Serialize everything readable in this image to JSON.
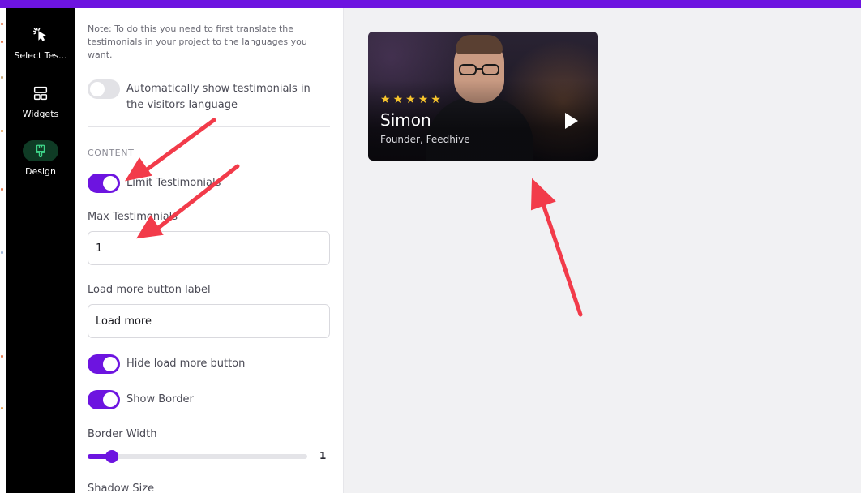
{
  "rail": {
    "items": [
      {
        "label": "Select Tes...",
        "icon": "cursor-click-icon"
      },
      {
        "label": "Widgets",
        "icon": "layout-icon"
      },
      {
        "label": "Design",
        "icon": "paintbrush-icon"
      }
    ]
  },
  "panel": {
    "note": "Note: To do this you need to first translate the testimonials in your project to the languages you want.",
    "auto_translate_label": "Automatically show testimonials in the visitors language",
    "auto_translate_on": false,
    "section_title": "CONTENT",
    "limit_label": "Limit Testimonials",
    "limit_on": true,
    "max_label": "Max Testimonials",
    "max_value": "1",
    "load_more_label": "Load more button label",
    "load_more_value": "Load more",
    "hide_load_more_label": "Hide load more button",
    "hide_load_more_on": true,
    "show_border_label": "Show Border",
    "show_border_on": true,
    "border_width_label": "Border Width",
    "border_width_value": "1",
    "border_width_fraction": 0.11,
    "shadow_label": "Shadow Size"
  },
  "card": {
    "stars": 5,
    "name": "Simon",
    "role": "Founder, Feedhive"
  },
  "colors": {
    "accent": "#6d14e0",
    "star": "#f7c42c",
    "annotation_arrow": "#f23b4a"
  }
}
